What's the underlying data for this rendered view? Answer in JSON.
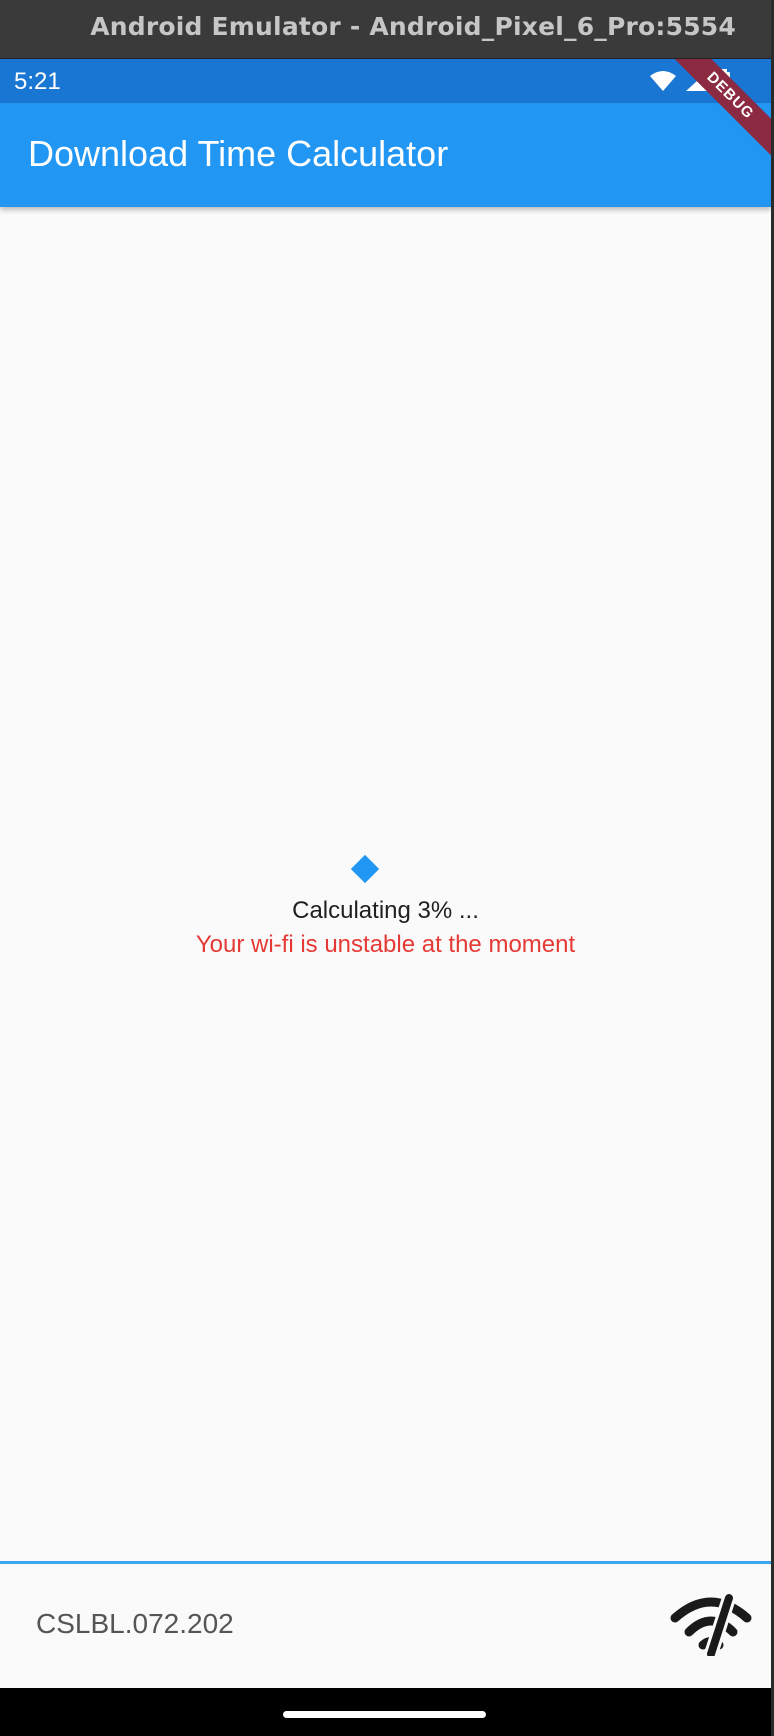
{
  "window": {
    "title": "Android Emulator - Android_Pixel_6_Pro:5554"
  },
  "status_bar": {
    "time": "5:21",
    "icons": [
      "wifi-icon",
      "cell-signal-icon",
      "battery-icon"
    ]
  },
  "debug_banner": {
    "label": "DEBUG"
  },
  "app_bar": {
    "title": "Download Time Calculator"
  },
  "content": {
    "progress_text": "Calculating 3% ...",
    "warning_text": "Your wi-fi is unstable at the moment"
  },
  "footer": {
    "version": "CSLBL.072.202",
    "icon": "wifi-off-icon"
  },
  "colors": {
    "status_bar": "#1976d2",
    "app_bar": "#2196f3",
    "warning": "#e53935",
    "debug_banner": "#8b2a40"
  }
}
